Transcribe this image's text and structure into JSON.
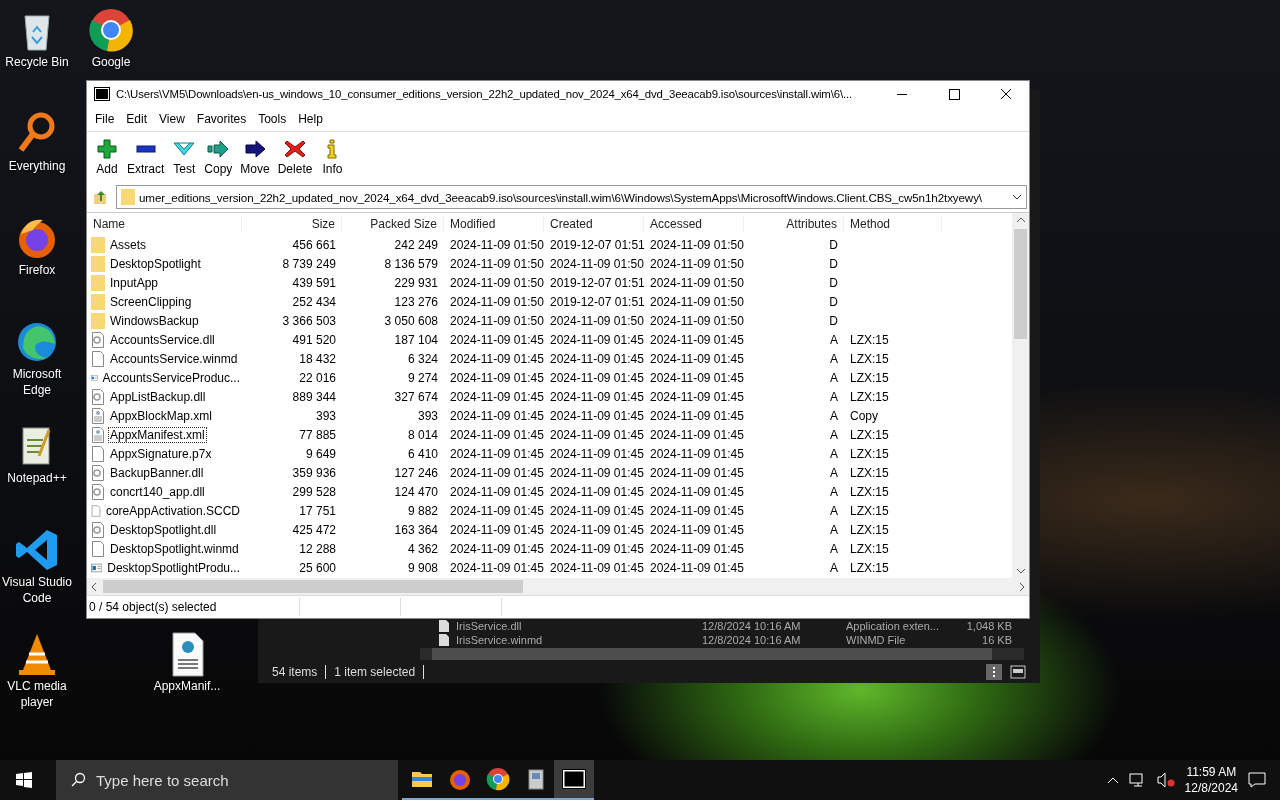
{
  "desktop_icons": [
    {
      "label": "Recycle Bin",
      "kind": "recycle"
    },
    {
      "label": "Everything",
      "kind": "everything"
    },
    {
      "label": "Firefox",
      "kind": "firefox"
    },
    {
      "label": "Microsoft Edge",
      "kind": "edge"
    },
    {
      "label": "Notepad++",
      "kind": "notepad"
    },
    {
      "label": "Visual Studio Code",
      "kind": "vscode"
    },
    {
      "label": "VLC media player",
      "kind": "vlc"
    }
  ],
  "desktop_icons_2": [
    {
      "label": "Google",
      "kind": "chrome"
    },
    {
      "label": "AppxManif...",
      "kind": "xmlfile"
    }
  ],
  "explorer_window": {
    "rows": [
      {
        "name": "IrisService.dll",
        "date": "12/8/2024 10:16 AM",
        "type": "Application exten...",
        "size": "1,048 KB"
      },
      {
        "name": "IrisService.winmd",
        "date": "12/8/2024 10:16 AM",
        "type": "WINMD File",
        "size": "16 KB"
      }
    ],
    "status_items": "54 items",
    "status_selected": "1 item selected"
  },
  "window": {
    "title": "C:\\Users\\VM5\\Downloads\\en-us_windows_10_consumer_editions_version_22h2_updated_nov_2024_x64_dvd_3eeacab9.iso\\sources\\install.wim\\6\\...",
    "menu": [
      "File",
      "Edit",
      "View",
      "Favorites",
      "Tools",
      "Help"
    ],
    "toolbar": [
      {
        "label": "Add",
        "kind": "add"
      },
      {
        "label": "Extract",
        "kind": "extract"
      },
      {
        "label": "Test",
        "kind": "test"
      },
      {
        "label": "Copy",
        "kind": "copy"
      },
      {
        "label": "Move",
        "kind": "move"
      },
      {
        "label": "Delete",
        "kind": "delete"
      },
      {
        "label": "Info",
        "kind": "info"
      }
    ],
    "address": "umer_editions_version_22h2_updated_nov_2024_x64_dvd_3eeacab9.iso\\sources\\install.wim\\6\\Windows\\SystemApps\\MicrosoftWindows.Client.CBS_cw5n1h2txyewy\\",
    "columns": [
      "Name",
      "Size",
      "Packed Size",
      "Modified",
      "Created",
      "Accessed",
      "Attributes",
      "Method"
    ],
    "rows": [
      {
        "kind": "folder",
        "focused": false,
        "name": "Assets",
        "size": "456 661",
        "packed": "242 249",
        "modified": "2024-11-09 01:50",
        "created": "2019-12-07 01:51",
        "accessed": "2024-11-09 01:50",
        "attributes": "D"
      },
      {
        "kind": "folder",
        "focused": false,
        "name": "DesktopSpotlight",
        "size": "8 739 249",
        "packed": "8 136 579",
        "modified": "2024-11-09 01:50",
        "created": "2024-11-09 01:50",
        "accessed": "2024-11-09 01:50",
        "attributes": "D"
      },
      {
        "kind": "folder",
        "focused": false,
        "name": "InputApp",
        "size": "439 591",
        "packed": "229 931",
        "modified": "2024-11-09 01:50",
        "created": "2019-12-07 01:51",
        "accessed": "2024-11-09 01:50",
        "attributes": "D"
      },
      {
        "kind": "folder",
        "focused": false,
        "name": "ScreenClipping",
        "size": "252 434",
        "packed": "123 276",
        "modified": "2024-11-09 01:50",
        "created": "2019-12-07 01:51",
        "accessed": "2024-11-09 01:50",
        "attributes": "D"
      },
      {
        "kind": "folder",
        "focused": false,
        "name": "WindowsBackup",
        "size": "3 366 503",
        "packed": "3 050 608",
        "modified": "2024-11-09 01:50",
        "created": "2024-11-09 01:50",
        "accessed": "2024-11-09 01:50",
        "attributes": "D"
      },
      {
        "kind": "dll",
        "focused": false,
        "name": "AccountsService.dll",
        "size": "491 520",
        "packed": "187 104",
        "modified": "2024-11-09 01:45",
        "created": "2024-11-09 01:45",
        "accessed": "2024-11-09 01:45",
        "attributes": "A",
        "method": "LZX:15"
      },
      {
        "kind": "file",
        "focused": false,
        "name": "AccountsService.winmd",
        "size": "18 432",
        "packed": "6 324",
        "modified": "2024-11-09 01:45",
        "created": "2024-11-09 01:45",
        "accessed": "2024-11-09 01:45",
        "attributes": "A",
        "method": "LZX:15"
      },
      {
        "kind": "exe",
        "focused": false,
        "name": "AccountsServiceProduc...",
        "size": "22 016",
        "packed": "9 274",
        "modified": "2024-11-09 01:45",
        "created": "2024-11-09 01:45",
        "accessed": "2024-11-09 01:45",
        "attributes": "A",
        "method": "LZX:15"
      },
      {
        "kind": "dll",
        "focused": false,
        "name": "AppListBackup.dll",
        "size": "889 344",
        "packed": "327 674",
        "modified": "2024-11-09 01:45",
        "created": "2024-11-09 01:45",
        "accessed": "2024-11-09 01:45",
        "attributes": "A",
        "method": "LZX:15"
      },
      {
        "kind": "xml",
        "focused": false,
        "name": "AppxBlockMap.xml",
        "size": "393",
        "packed": "393",
        "modified": "2024-11-09 01:45",
        "created": "2024-11-09 01:45",
        "accessed": "2024-11-09 01:45",
        "attributes": "A",
        "method": "Copy"
      },
      {
        "kind": "xml",
        "focused": true,
        "name": "AppxManifest.xml",
        "size": "77 885",
        "packed": "8 014",
        "modified": "2024-11-09 01:45",
        "created": "2024-11-09 01:45",
        "accessed": "2024-11-09 01:45",
        "attributes": "A",
        "method": "LZX:15"
      },
      {
        "kind": "file",
        "focused": false,
        "name": "AppxSignature.p7x",
        "size": "9 649",
        "packed": "6 410",
        "modified": "2024-11-09 01:45",
        "created": "2024-11-09 01:45",
        "accessed": "2024-11-09 01:45",
        "attributes": "A",
        "method": "LZX:15"
      },
      {
        "kind": "dll",
        "focused": false,
        "name": "BackupBanner.dll",
        "size": "359 936",
        "packed": "127 246",
        "modified": "2024-11-09 01:45",
        "created": "2024-11-09 01:45",
        "accessed": "2024-11-09 01:45",
        "attributes": "A",
        "method": "LZX:15"
      },
      {
        "kind": "dll",
        "focused": false,
        "name": "concrt140_app.dll",
        "size": "299 528",
        "packed": "124 470",
        "modified": "2024-11-09 01:45",
        "created": "2024-11-09 01:45",
        "accessed": "2024-11-09 01:45",
        "attributes": "A",
        "method": "LZX:15"
      },
      {
        "kind": "file",
        "focused": false,
        "name": "coreAppActivation.SCCD",
        "size": "17 751",
        "packed": "9 882",
        "modified": "2024-11-09 01:45",
        "created": "2024-11-09 01:45",
        "accessed": "2024-11-09 01:45",
        "attributes": "A",
        "method": "LZX:15"
      },
      {
        "kind": "dll",
        "focused": false,
        "name": "DesktopSpotlight.dll",
        "size": "425 472",
        "packed": "163 364",
        "modified": "2024-11-09 01:45",
        "created": "2024-11-09 01:45",
        "accessed": "2024-11-09 01:45",
        "attributes": "A",
        "method": "LZX:15"
      },
      {
        "kind": "file",
        "focused": false,
        "name": "DesktopSpotlight.winmd",
        "size": "12 288",
        "packed": "4 362",
        "modified": "2024-11-09 01:45",
        "created": "2024-11-09 01:45",
        "accessed": "2024-11-09 01:45",
        "attributes": "A",
        "method": "LZX:15"
      },
      {
        "kind": "exe",
        "focused": false,
        "name": "DesktopSpotlightProdu...",
        "size": "25 600",
        "packed": "9 908",
        "modified": "2024-11-09 01:45",
        "created": "2024-11-09 01:45",
        "accessed": "2024-11-09 01:45",
        "attributes": "A",
        "method": "LZX:15"
      }
    ],
    "status": "0 / 54 object(s) selected"
  },
  "taskbar": {
    "search_placeholder": "Type here to search",
    "apps": [
      {
        "kind": "explorer",
        "active": false
      },
      {
        "kind": "firefox",
        "active": false
      },
      {
        "kind": "chrome",
        "active": false
      },
      {
        "kind": "archive",
        "active": false
      },
      {
        "kind": "sevenzip",
        "active": true
      }
    ],
    "time": "11:59 AM",
    "date": "12/8/2024"
  }
}
